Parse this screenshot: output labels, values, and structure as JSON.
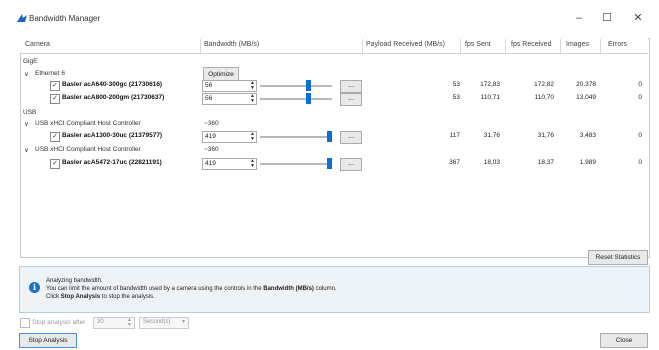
{
  "window": {
    "title": "Bandwidth Manager",
    "minimize": "–",
    "maximize": "☐",
    "close": "✕"
  },
  "columns": [
    "Camera",
    "Bandwidth (MB/s)",
    "Payload Received (MB/s)",
    "fps Sent",
    "fps Received",
    "Images",
    "Errors"
  ],
  "groups": {
    "gige": "GigE",
    "ethernet": "Ethernet 6",
    "optimize": "Optimize",
    "usb": "USB",
    "ctrl1": "USB xHCI Compliant Host Controller",
    "ctrl1_bw": "~360",
    "ctrl2": "USB xHCI Compliant Host Controller",
    "ctrl2_bw": "~360"
  },
  "cameras": [
    {
      "name": "Basler acA640-300gc (21730616)",
      "bandwidth": "56",
      "slider_fraction": 0.68,
      "payload": "53",
      "fps_sent": "172,83",
      "fps_received": "172,82",
      "images": "20.378",
      "errors": "0"
    },
    {
      "name": "Basler acA800-200gm (21730637)",
      "bandwidth": "56",
      "slider_fraction": 0.68,
      "payload": "53",
      "fps_sent": "110,71",
      "fps_received": "110,70",
      "images": "13.049",
      "errors": "0"
    },
    {
      "name": "Basler acA1300-30uc (21379577)",
      "bandwidth": "419",
      "slider_fraction": 1.0,
      "payload": "117",
      "fps_sent": "31,76",
      "fps_received": "31,76",
      "images": "3.483",
      "errors": "0"
    },
    {
      "name": "Basler acA5472-17uc (22821191)",
      "bandwidth": "419",
      "slider_fraction": 1.0,
      "payload": "367",
      "fps_sent": "18,03",
      "fps_received": "18,37",
      "images": "1.989",
      "errors": "0"
    }
  ],
  "dots_label": "...",
  "reset_statistics": "Reset Statistics",
  "info": {
    "line1": "Analyzing bandwidth.",
    "line2a": "You can limit the amount of bandwidth used by a camera using the controls in the ",
    "line2b": "Bandwidth (MB/s)",
    "line2c": " column.",
    "line3a": "Click ",
    "line3b": "Stop Analysis",
    "line3c": " to stop the analysis."
  },
  "stop_after": {
    "label": "Stop analysis after",
    "value": "30",
    "unit": "Second(s)"
  },
  "stop_analysis": "Stop Analysis",
  "close_button": "Close",
  "colors": {
    "accent": "#0b6fd6",
    "info_icon": "#1a73c9"
  }
}
